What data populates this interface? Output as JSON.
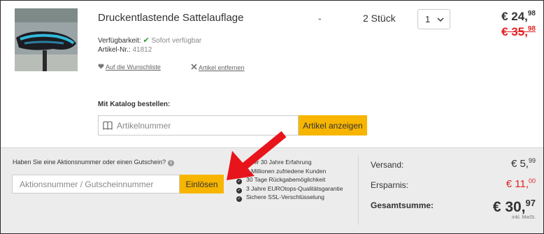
{
  "product": {
    "image_icon": "saddle-cover-photo",
    "title": "Druckentlastende Sattelauflage",
    "dash": "-",
    "quantity_text": "2 Stück",
    "quantity_select": "1",
    "price_new_main": "€ 24,",
    "price_new_cents": "98",
    "price_old_main": "€ 35,",
    "price_old_cents": "98",
    "availability_label": "Verfügbarkeit:",
    "availability_value": "Sofort verfügbar",
    "article_label": "Artikel-Nr.:",
    "article_value": "41812",
    "wishlist_link": "Auf die Wunschliste",
    "remove_link": "Artikel entfernen"
  },
  "catalog": {
    "label": "Mit Katalog bestellen:",
    "placeholder": "Artikelnummer",
    "button": "Artikel anzeigen"
  },
  "voucher": {
    "question": "Haben Sie eine Aktionsnummer oder einen Gutschein?",
    "placeholder": "Aktionsnummer / Gutscheinnummer",
    "button": "Einlösen"
  },
  "benefits": [
    "Über 30 Jahre Erfahrung",
    "5 Millionen zufriedene Kunden",
    "30 Tage Rückgabemöglichkeit",
    "3 Jahre EUROtops-Qualitätsgarantie",
    "Sichere SSL-Verschlüsselung"
  ],
  "summary": {
    "shipping_label": "Versand:",
    "shipping_main": "€ 5,",
    "shipping_cents": "99",
    "savings_label": "Ersparnis:",
    "savings_main": "€ 11,",
    "savings_cents": "00",
    "total_label": "Gesamtsumme:",
    "total_main": "€ 30,",
    "total_cents": "97",
    "vat_note": "inkl. MwSt."
  },
  "colors": {
    "accent_yellow": "#f7b500",
    "price_red": "#e32222",
    "available_green": "#2d9a2d",
    "arrow_red": "#e8141b"
  }
}
